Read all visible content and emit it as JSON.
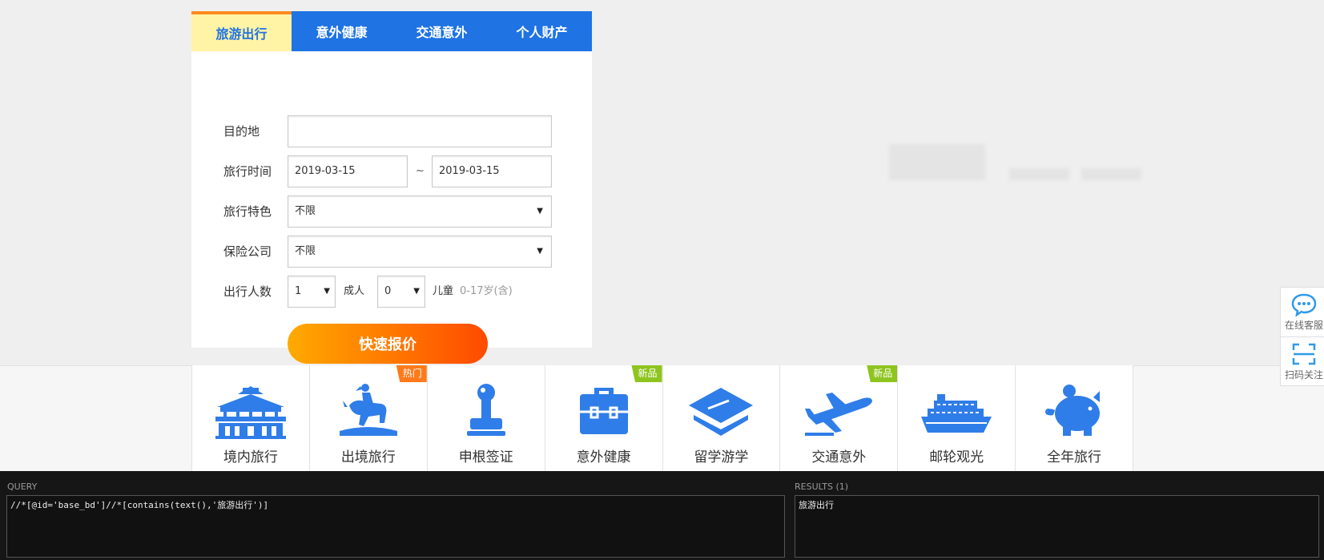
{
  "tabs": [
    {
      "label": "旅游出行",
      "active": true
    },
    {
      "label": "意外健康",
      "active": false
    },
    {
      "label": "交通意外",
      "active": false
    },
    {
      "label": "个人财产",
      "active": false
    }
  ],
  "form": {
    "destination_label": "目的地",
    "destination_value": "",
    "travel_time_label": "旅行时间",
    "start_date": "2019-03-15",
    "date_separator": "~",
    "end_date": "2019-03-15",
    "feature_label": "旅行特色",
    "feature_value": "不限",
    "company_label": "保险公司",
    "company_value": "不限",
    "people_label": "出行人数",
    "adults_value": "1",
    "adults_unit": "成人",
    "children_value": "0",
    "children_unit": "儿童",
    "children_hint": "0-17岁(含)",
    "submit_label": "快速报价"
  },
  "categories": [
    {
      "label": "境内旅行",
      "icon": "palace-icon",
      "badge": ""
    },
    {
      "label": "出境旅行",
      "icon": "horse-statue-icon",
      "badge": "热门"
    },
    {
      "label": "申根签证",
      "icon": "stamp-icon",
      "badge": ""
    },
    {
      "label": "意外健康",
      "icon": "briefcase-icon",
      "badge": "新品"
    },
    {
      "label": "留学游学",
      "icon": "graduation-cap-icon",
      "badge": ""
    },
    {
      "label": "交通意外",
      "icon": "airplane-icon",
      "badge": "新品"
    },
    {
      "label": "邮轮观光",
      "icon": "cruise-ship-icon",
      "badge": ""
    },
    {
      "label": "全年旅行",
      "icon": "piggy-bank-icon",
      "badge": ""
    }
  ],
  "float_service": {
    "online_label": "在线客服",
    "scan_label": "扫码关注"
  },
  "devtools": {
    "query_label": "QUERY",
    "query_text": "//*[@id='base_bd']//*[contains(text(),'旅游出行')]",
    "results_label": "RESULTS (1)",
    "result_text": "旅游出行"
  },
  "colors": {
    "tab_blue": "#1f73e3",
    "tab_active_bg": "#fff3a5",
    "icon_blue": "#2f7de8",
    "hot_badge": "#ff7a1a",
    "new_badge": "#8ec41e"
  }
}
